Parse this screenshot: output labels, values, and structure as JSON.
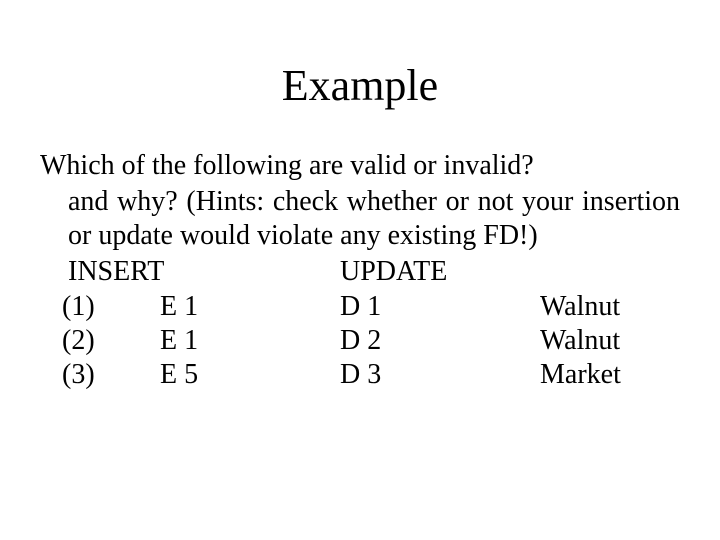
{
  "title": "Example",
  "question": {
    "line1": "Which of the following are valid or invalid?",
    "rest": "and why? (Hints: check whether or not your insertion or update would violate any existing FD!)"
  },
  "headers": {
    "insert": "INSERT",
    "update": "UPDATE"
  },
  "rows": [
    {
      "num": "(1)",
      "col1": "E 1",
      "col2": "D 1",
      "col3": "Walnut"
    },
    {
      "num": "(2)",
      "col1": "E 1",
      "col2": "D 2",
      "col3": "Walnut"
    },
    {
      "num": "(3)",
      "col1": "E 5",
      "col2": "D 3",
      "col3": "Market"
    }
  ]
}
